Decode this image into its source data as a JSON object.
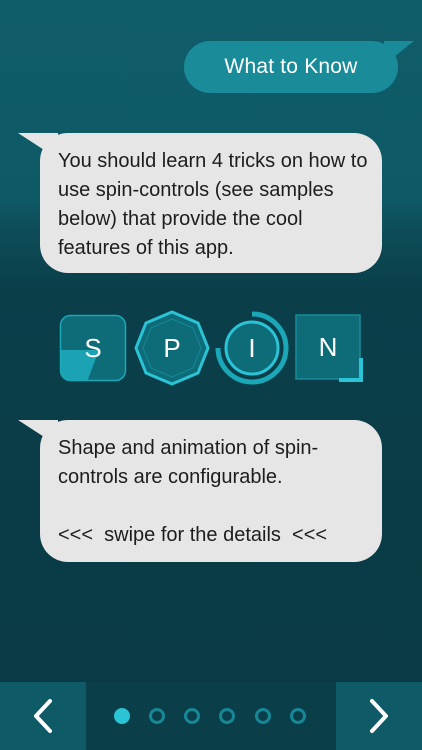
{
  "header": {
    "title": "What to Know"
  },
  "messages": {
    "intro": "You should learn 4 tricks on how to use spin-controls (see samples below) that provide the cool features of this app.",
    "config_line1": "Shape and animation of spin-controls are configurable.",
    "swipe_hint": "<<<  swipe for the details  <<<"
  },
  "spin_controls": [
    {
      "letter": "S",
      "icon": "rounded-square-spin-control"
    },
    {
      "letter": "P",
      "icon": "octagon-spin-control"
    },
    {
      "letter": "I",
      "icon": "circle-arc-spin-control"
    },
    {
      "letter": "N",
      "icon": "square-corner-spin-control"
    }
  ],
  "pager": {
    "page_count": 6,
    "current_page": 1
  },
  "navigation": {
    "prev_icon": "chevron-left-icon",
    "next_icon": "chevron-right-icon"
  },
  "colors": {
    "accent": "#1a8b99",
    "accent_bright": "#2bc3d6",
    "bubble": "#e6e6e6",
    "background": "#093a45"
  }
}
